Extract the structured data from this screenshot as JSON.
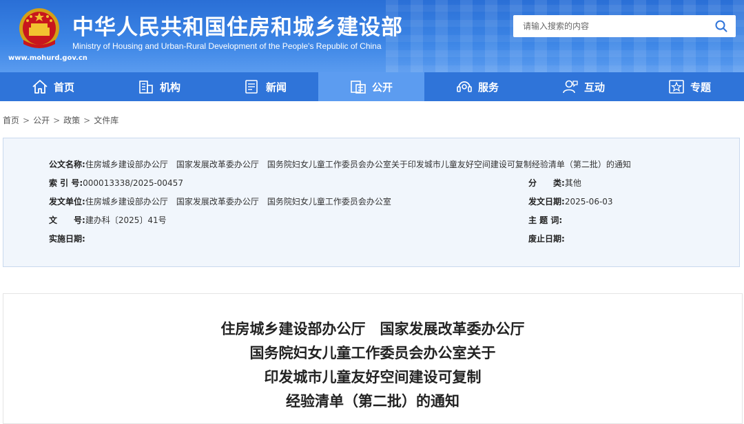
{
  "header": {
    "title_cn": "中华人民共和国住房和城乡建设部",
    "title_en": "Ministry of Housing and Urban-Rural Development of the People's Republic of China",
    "site_url": "www.mohurd.gov.cn",
    "search_placeholder": "请输入搜索的内容"
  },
  "nav": {
    "items": [
      {
        "label": "首页",
        "icon": "home-icon"
      },
      {
        "label": "机构",
        "icon": "building-icon"
      },
      {
        "label": "新闻",
        "icon": "newspaper-icon"
      },
      {
        "label": "公开",
        "icon": "document-icon"
      },
      {
        "label": "服务",
        "icon": "service-icon"
      },
      {
        "label": "互动",
        "icon": "user-interact-icon"
      },
      {
        "label": "专题",
        "icon": "star-icon"
      }
    ],
    "active": "公开"
  },
  "breadcrumb": [
    "首页",
    "公开",
    "政策",
    "文件库"
  ],
  "info": {
    "title_label": "公文名称:",
    "title_value": "住房城乡建设部办公厅　国家发展改革委办公厅　国务院妇女儿童工作委员会办公室关于印发城市儿童友好空间建设可复制经验清单（第二批）的通知",
    "index_label": "索 引 号:",
    "index_value": "000013338/2025-00457",
    "category_label": "分　　类:",
    "category_value": "其他",
    "issuer_label": "发文单位:",
    "issuer_value": "住房城乡建设部办公厅　国家发展改革委办公厅　国务院妇女儿童工作委员会办公室",
    "date_label": "发文日期:",
    "date_value": "2025-06-03",
    "docno_label": "文　　号:",
    "docno_value": "建办科〔2025〕41号",
    "subject_label": "主 题 词:",
    "subject_value": "",
    "effective_label": "实施日期:",
    "effective_value": "",
    "repeal_label": "废止日期:",
    "repeal_value": ""
  },
  "article": {
    "title_lines": [
      "住房城乡建设部办公厅　国家发展改革委办公厅",
      "国务院妇女儿童工作委员会办公室关于",
      "印发城市儿童友好空间建设可复制",
      "经验清单（第二批）的通知"
    ]
  },
  "colors": {
    "header_blue": "#2a6fd6",
    "nav_blue": "#2f74d9",
    "nav_active": "#5c9cf0",
    "info_bg": "#f1f6fc"
  }
}
